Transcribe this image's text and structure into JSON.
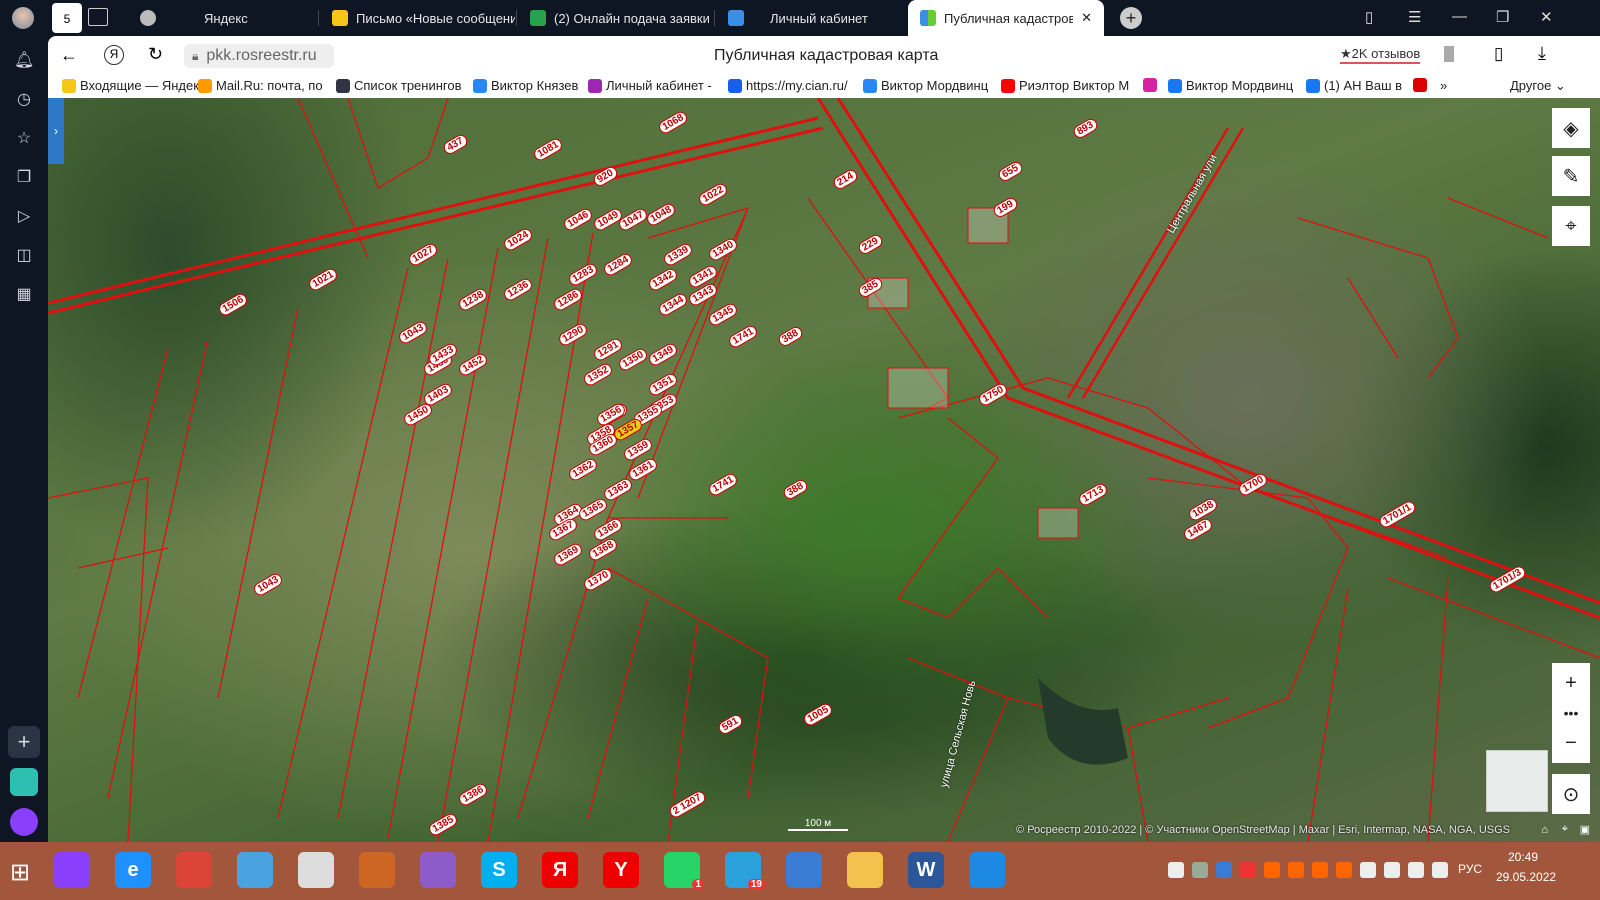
{
  "tabs": [
    {
      "label": "Яндекс",
      "color": "#aaa"
    },
    {
      "label": "Письмо «Новые сообщения»",
      "color": "#f5c518"
    },
    {
      "label": "(2) Онлайн подача заявки",
      "color": "#2aa14b"
    },
    {
      "label": "Личный кабинет",
      "color": "#3a8ee6"
    },
    {
      "label": "Публичная кадастровая карта",
      "color": "#3a8ee6",
      "active": true
    }
  ],
  "tab_counter": "5",
  "address": {
    "url": "pkk.rosreestr.ru",
    "page_title": "Публичная кадастровая карта",
    "reviews": "★2K отзывов"
  },
  "bookmarks": [
    {
      "label": "Входящие — Яндекс",
      "color": "#f5c518"
    },
    {
      "label": "Mail.Ru: почта, по",
      "color": "#f90"
    },
    {
      "label": "Список тренингов",
      "color": "#334"
    },
    {
      "label": "Виктор Князев",
      "color": "#2787f5"
    },
    {
      "label": "Личный кабинет -",
      "color": "#9c27b0"
    },
    {
      "label": "https://my.cian.ru/",
      "color": "#1a5ef0"
    },
    {
      "label": "Виктор Мордвинц",
      "color": "#2787f5"
    },
    {
      "label": "Риэлтор Виктор М",
      "color": "#f00"
    },
    {
      "label": "",
      "color": "#d6249f"
    },
    {
      "label": "Виктор Мордвинц",
      "color": "#1877f2"
    },
    {
      "label": "(1) АН Ваш в",
      "color": "#1877f2"
    },
    {
      "label": "",
      "color": "#d00"
    }
  ],
  "bookmarks_more": "»",
  "bookmarks_other": "Другое ⌄",
  "map": {
    "parcels": [
      "437",
      "1068",
      "1081",
      "920",
      "1022",
      "1046",
      "1049",
      "1047",
      "1048",
      "1024",
      "1027",
      "1021",
      "1506",
      "1339",
      "1340",
      "1283",
      "1284",
      "1342",
      "1341",
      "1238",
      "1236",
      "1286",
      "1343",
      "1344",
      "1345",
      "1043",
      "1741",
      "388",
      "1290",
      "1291",
      "1350",
      "1349",
      "1352",
      "1351",
      "1354",
      "1353",
      "1356",
      "1355",
      "1357",
      "1358",
      "1359",
      "1360",
      "1361",
      "1362",
      "1363",
      "1364",
      "1365",
      "1366",
      "1367",
      "1368",
      "1369",
      "1370",
      "1385",
      "1386",
      "1043",
      "1713",
      "1750",
      "1700",
      "1701/1",
      "1701/3",
      "385",
      "229",
      "214",
      "199",
      "655",
      "893",
      "1038",
      "1467",
      "1005",
      "2 1207",
      "591",
      "388",
      "1741",
      "1403",
      "1430",
      "1452",
      "1433",
      "1450"
    ],
    "selected": "1357",
    "street1": "Центральная ули",
    "street2": "улица Сельская Новь",
    "scale": "100 м",
    "attribution": "© Росреестр 2010-2022 | © Участники OpenStreetMap | Maxar | Esri, Intermap, NASA, NGA, USGS"
  },
  "taskbar": {
    "lang": "РУС",
    "time": "20:49",
    "date": "29.05.2022",
    "whatsapp_badge": "1",
    "telegram_badge": "19"
  }
}
